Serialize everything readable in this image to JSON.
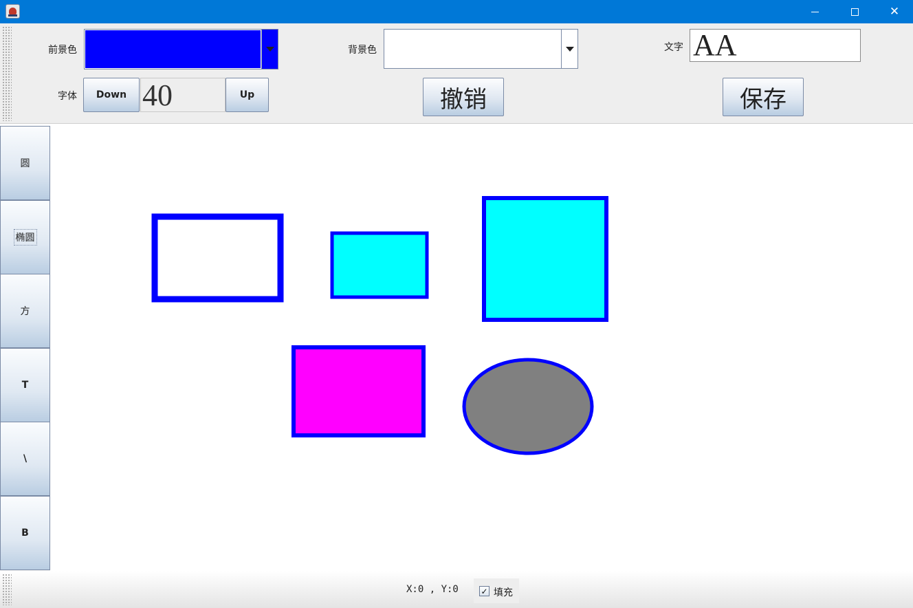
{
  "window": {
    "app_icon": "java-cup-icon",
    "controls": {
      "minimize": "minimize-icon",
      "maximize": "maximize-icon",
      "close": "✕"
    }
  },
  "toolbar": {
    "foreground_label": "前景色",
    "foreground_color": "#0000ff",
    "background_label": "背景色",
    "background_color": "#ffffff",
    "text_label": "文字",
    "text_value": "AA",
    "font_label": "字体",
    "font_down": "Down",
    "font_size": "40",
    "font_up": "Up",
    "undo": "撤销",
    "save": "保存"
  },
  "tools": [
    {
      "label": "圆",
      "bold": false
    },
    {
      "label": "椭圆",
      "bold": false,
      "focused": true
    },
    {
      "label": "方",
      "bold": false
    },
    {
      "label": "T",
      "bold": true
    },
    {
      "label": "\\",
      "bold": true
    },
    {
      "label": "B",
      "bold": true
    }
  ],
  "colors": {
    "titlebar": "#0078d7",
    "stroke": "#0000ff",
    "cyan": "#00ffff",
    "magenta": "#ff00ff",
    "gray": "#808080",
    "white": "#ffffff"
  },
  "status": {
    "coords": "X:0 , Y:0",
    "fill_label": "填充",
    "fill_checked": true
  }
}
